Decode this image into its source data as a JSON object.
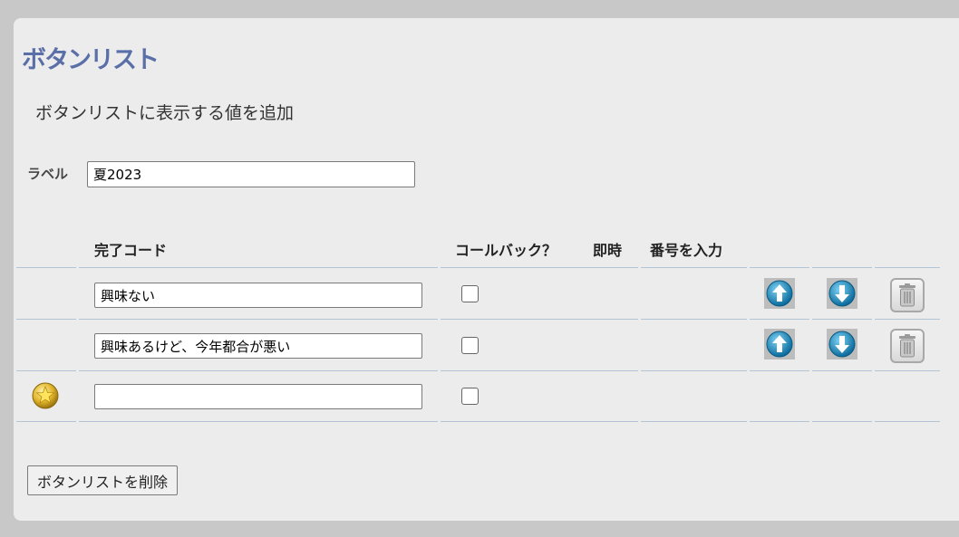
{
  "header": {
    "title": "ボタンリスト",
    "subtitle": "ボタンリストに表示する値を追加"
  },
  "label_field": {
    "label": "ラベル",
    "value": "夏2023"
  },
  "table": {
    "columns": {
      "completion_code": "完了コード",
      "callback": "コールバック？",
      "immediate": "即時",
      "enter_number": "番号を入力"
    },
    "rows": [
      {
        "value": "興味ない",
        "callback": false
      },
      {
        "value": "興味あるけど、今年都合が悪い",
        "callback": false
      },
      {
        "value": "",
        "callback": false
      }
    ]
  },
  "actions": {
    "delete_list_label": "ボタンリストを削除"
  },
  "icons": {
    "move_up": "arrow-up-icon",
    "move_down": "arrow-down-icon",
    "delete": "trash-icon",
    "new_row": "star-icon"
  },
  "colors": {
    "title": "#5a6fa8",
    "panel_bg": "#ececec",
    "row_divider": "#b3c4d6",
    "arrow_blue": "#1a8fbf"
  }
}
